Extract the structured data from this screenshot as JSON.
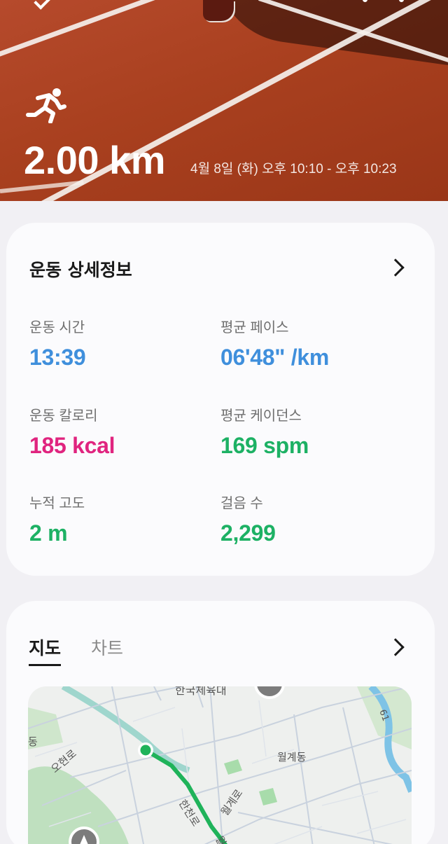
{
  "hero": {
    "distance": "2.00 km",
    "datetime": "4월 8일 (화) 오후 10:10 - 오후 10:23"
  },
  "details": {
    "title": "운동 상세정보",
    "metrics": [
      {
        "label": "운동 시간",
        "value": "13:39",
        "color": "#3f8fdc"
      },
      {
        "label": "평균 페이스",
        "value": "06'48\" /km",
        "color": "#3f8fdc"
      },
      {
        "label": "운동 칼로리",
        "value": "185 kcal",
        "color": "#e0247f"
      },
      {
        "label": "평균 케이던스",
        "value": "169 spm",
        "color": "#1db164"
      },
      {
        "label": "누적 고도",
        "value": "2 m",
        "color": "#1db164"
      },
      {
        "label": "걸음 수",
        "value": "2,299",
        "color": "#1db164"
      }
    ]
  },
  "map_card": {
    "tabs": [
      "지도",
      "차트"
    ],
    "active_tab": "지도",
    "map_labels": {
      "top": "한국체육대",
      "left_partial": "동",
      "ohyeonro": "오현로",
      "wolgyedong": "월계동",
      "hancheonro": "한천로",
      "wolgyero": "월계로",
      "wolgyero2": "월계로",
      "route_number": "61"
    }
  },
  "icons": {
    "back": "back-arrow-icon",
    "more": "more-vertical-icon",
    "activity": "running-icon",
    "details_chevron": "chevron-right-icon",
    "map_chevron": "chevron-right-icon"
  }
}
